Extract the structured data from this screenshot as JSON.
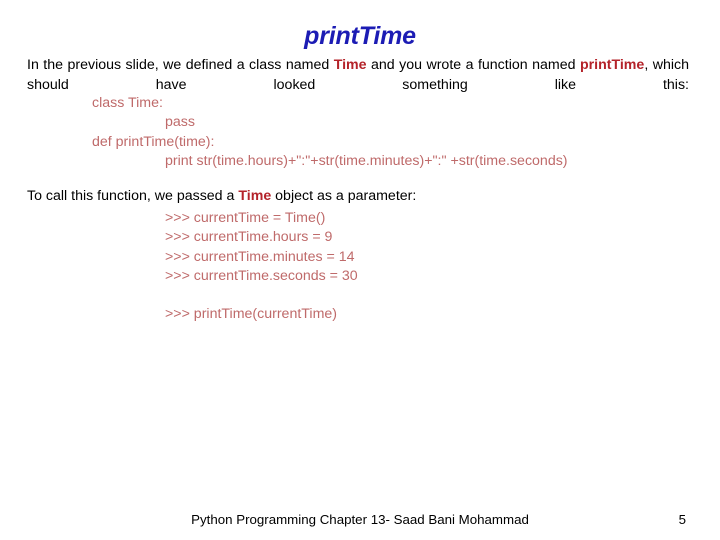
{
  "slide": {
    "title": "printTime",
    "title_color": "#1C1CB4",
    "keyword_color": "#B4232A",
    "code_color": "#BF6A6A",
    "background": "#ffffff"
  },
  "intro": {
    "seg_1": "In the previous slide, we defined a class named ",
    "kw_1": "Time",
    "seg_2": " and you wrote a function named ",
    "kw_2": "printTime",
    "seg_3": ", which should have looked something like this:"
  },
  "code": {
    "lines": [
      {
        "text": "class Time:",
        "indent": 1
      },
      {
        "text": "pass",
        "indent": 2
      },
      {
        "text": "def printTime(time):",
        "indent": 1
      },
      {
        "text": "print str(time.hours)+\":\"+str(time.minutes)+\":\" +str(time.seconds)",
        "indent": 2
      }
    ]
  },
  "call": {
    "seg_1": "To call this function, we passed a ",
    "kw_1": "Time",
    "seg_2": " object as a parameter:"
  },
  "console": {
    "lines": [
      ">>> currentTime = Time()",
      ">>> currentTime.hours = 9",
      ">>> currentTime.minutes = 14",
      ">>> currentTime.seconds = 30"
    ],
    "final_line": ">>> printTime(currentTime)"
  },
  "footer": {
    "text": "Python Programming Chapter 13- Saad Bani Mohammad",
    "page_number": "5"
  }
}
